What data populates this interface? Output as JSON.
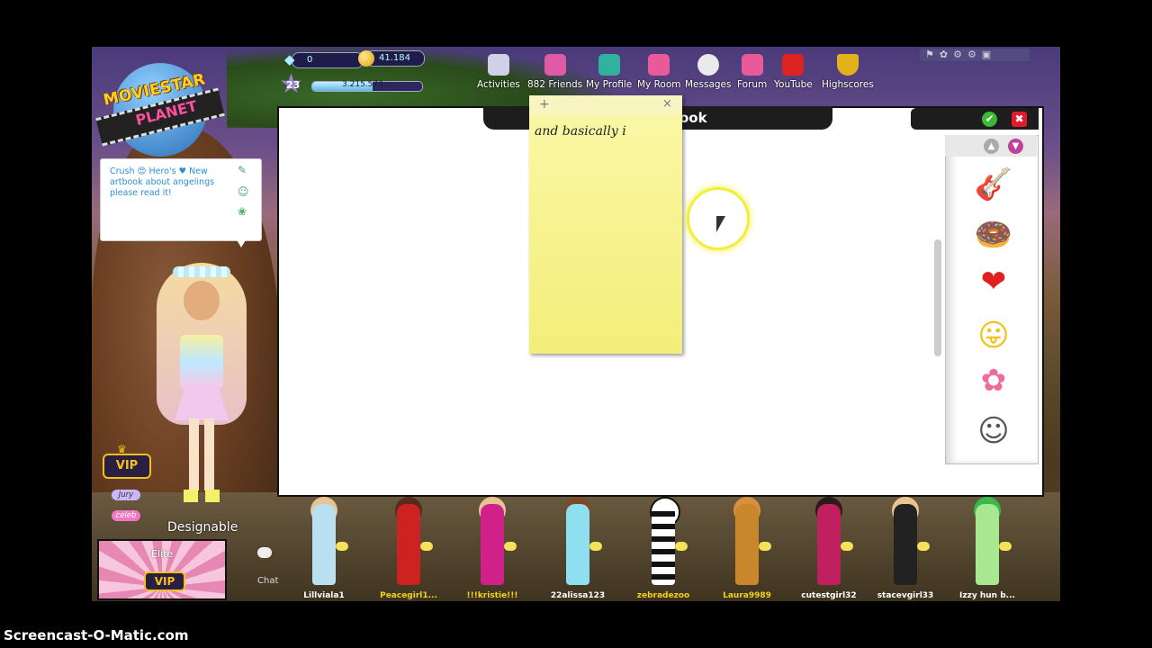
{
  "logo": {
    "line1": "MOVIESTAR",
    "line2": "PLANET"
  },
  "stats": {
    "diamonds": "0",
    "starcoins": "41.184",
    "level": "23",
    "fame": "3.215.573",
    "fame_progress_fraction": 0.55
  },
  "nav": [
    {
      "label": "Activities",
      "icon": "activities-icon"
    },
    {
      "label": "882 Friends",
      "icon": "friends-icon"
    },
    {
      "label": "My Profile",
      "icon": "profile-icon"
    },
    {
      "label": "My Room",
      "icon": "room-icon"
    },
    {
      "label": "Messages",
      "icon": "messages-icon"
    },
    {
      "label": "Forum",
      "icon": "forum-icon"
    },
    {
      "label": "YouTube",
      "icon": "youtube-icon"
    },
    {
      "label": "Highscores",
      "icon": "trophy-icon"
    }
  ],
  "utility_icons": [
    "flag-icon",
    "settings-icon",
    "sound-icon",
    "gear-icon",
    "fullscreen-icon"
  ],
  "status_bubble": {
    "text": "Crush 😍 Hero's ♥ New artbook about angelings please read it!"
  },
  "sidebar": {
    "vip_label": "VIP",
    "jury_label": "Jury",
    "celeb_label": "celeb",
    "designable_label": "Designable",
    "elite_label": "Elite",
    "elite_vip_label": "VIP",
    "chat_label": "Chat"
  },
  "artbook": {
    "title": "ook",
    "ok_label": "✔",
    "cancel_label": "✖"
  },
  "sticky_note": {
    "plus_label": "+",
    "close_label": "×",
    "text": "and basically i"
  },
  "stickers": [
    {
      "icon": "guitar-icon",
      "glyph": "🎸"
    },
    {
      "icon": "donut-icon",
      "glyph": "🍩"
    },
    {
      "icon": "heart-icon",
      "glyph": "❤"
    },
    {
      "icon": "tongue-emoji-icon",
      "glyph": "😛"
    },
    {
      "icon": "flower-icon",
      "glyph": "✿"
    },
    {
      "icon": "stick-figures-icon",
      "glyph": "☺"
    }
  ],
  "peers": [
    {
      "name": "Lillviala1",
      "color": "#ffffff"
    },
    {
      "name": "Peacegirl1...",
      "color": "#f2d21a"
    },
    {
      "name": "!!!kristie!!!",
      "color": "#f2d21a"
    },
    {
      "name": "22alissa123",
      "color": "#ffffff"
    },
    {
      "name": "zebradezoo",
      "color": "#f2d21a"
    },
    {
      "name": "Laura9989",
      "color": "#f2d21a"
    },
    {
      "name": "cutestgirl32",
      "color": "#ffffff"
    },
    {
      "name": "stacevgirl33",
      "color": "#ffffff"
    },
    {
      "name": "Izzy hun b...",
      "color": "#ffffff"
    }
  ],
  "watermark": "Screencast-O-Matic.com"
}
